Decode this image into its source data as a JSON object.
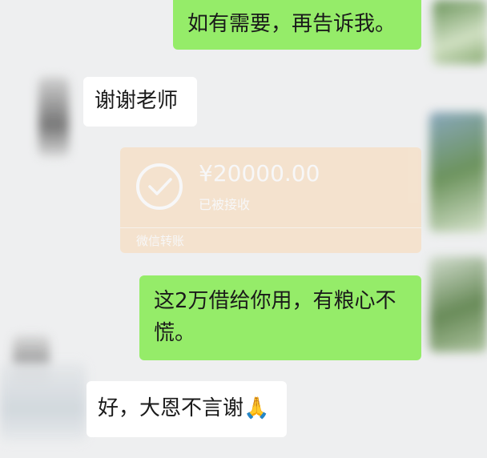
{
  "messages": [
    {
      "side": "right",
      "text": "如有需要，再告诉我。"
    },
    {
      "side": "left",
      "text": "谢谢老师"
    },
    {
      "side": "right",
      "text": "这2万借给你用，有粮心不慌。"
    },
    {
      "side": "left",
      "text": "好，大恩不言谢🙏"
    }
  ],
  "transfer": {
    "amount": "¥20000.00",
    "status": "已被接收",
    "footer": "微信转账",
    "icon": "check-circle-icon"
  },
  "colors": {
    "background": "#eeeff0",
    "sent_bubble": "#95ec69",
    "received_bubble": "#ffffff",
    "transfer_card": "#f9d9b4"
  }
}
